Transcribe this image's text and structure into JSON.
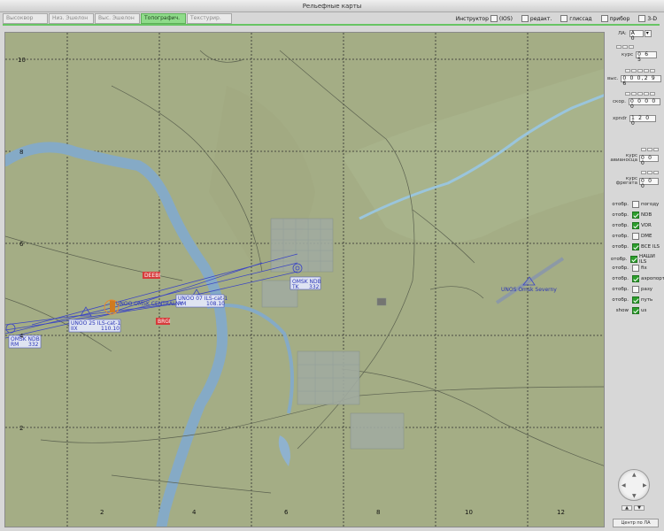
{
  "window": {
    "title": "Рельефные карты"
  },
  "tabs": [
    "Высоквор",
    "Низ. Эшелон",
    "Выс. Эшелон",
    "Топографич.",
    "Текстурир."
  ],
  "active_tab": 3,
  "options": [
    {
      "label": "Инструктор",
      "checked": false
    },
    {
      "label": "(IOS)",
      "checked": false
    },
    {
      "label": "редакт.",
      "checked": false
    },
    {
      "label": "глиссад",
      "checked": false
    },
    {
      "label": "прибор",
      "checked": false
    },
    {
      "label": "3-D",
      "checked": false
    }
  ],
  "map": {
    "y_ticks": [
      "10",
      "8",
      "6",
      "4",
      "2"
    ],
    "x_ticks": [
      "2",
      "4",
      "6",
      "8",
      "10",
      "12"
    ],
    "labels": {
      "ndb_main": "OMSK NDB",
      "ndb_main_tk": "TK",
      "ndb_main_val": "332",
      "ils_a": "UNOO 07  ILS-cat-1",
      "ils_a_tk": "RM",
      "ils_a_val": "108.10",
      "ils_b": "UNOO 25  ILS-cat-1",
      "ils_b_tk": "IIX",
      "ils_b_val": "110.10",
      "vor": "UNOO  OMSK CENTRALNY",
      "ndb_west": "OMSK NDB",
      "ndb_west_tk": "RM",
      "ndb_west_val": "332",
      "airport2": "UNOS  Omsk Severny",
      "red1": "DEEBI",
      "red2": "BRGI"
    }
  },
  "panel": {
    "la_label": "ЛА:",
    "la_value": "A 0",
    "kurs_label": "курс",
    "kurs_value": "0 6 5",
    "vys_label": "выс.",
    "vys_value": "0 0 0,2 9 6",
    "skor_label": "скор.",
    "skor_value": "0 0 0 0 0",
    "xpndr_label": "xpndr",
    "xpndr_value": "1 2 0 0",
    "kurs_avia_label": "курс авианосца",
    "kurs_avia_value": "0 0 0",
    "kurs_freg_label": "курс фрегата",
    "kurs_freg_value": "0 0 0",
    "layers": [
      {
        "t": "отобр.",
        "name": "погоду",
        "on": false
      },
      {
        "t": "отобр.",
        "name": "NDB",
        "on": true
      },
      {
        "t": "отобр.",
        "name": "VOR",
        "on": true
      },
      {
        "t": "отобр.",
        "name": "DME",
        "on": false
      },
      {
        "t": "отобр.",
        "name": "ВСЕ ILS",
        "on": true
      },
      {
        "t": "отобр.",
        "name": "НАШИ ILS",
        "on": true
      },
      {
        "t": "отобр.",
        "name": "fix",
        "on": false
      },
      {
        "t": "отобр.",
        "name": "аэропорт",
        "on": true
      },
      {
        "t": "отобр.",
        "name": "разу",
        "on": false
      },
      {
        "t": "отобр.",
        "name": "путь",
        "on": true
      },
      {
        "t": "show",
        "name": "us",
        "on": true
      }
    ],
    "center_btn": "Центр по ЛА"
  }
}
